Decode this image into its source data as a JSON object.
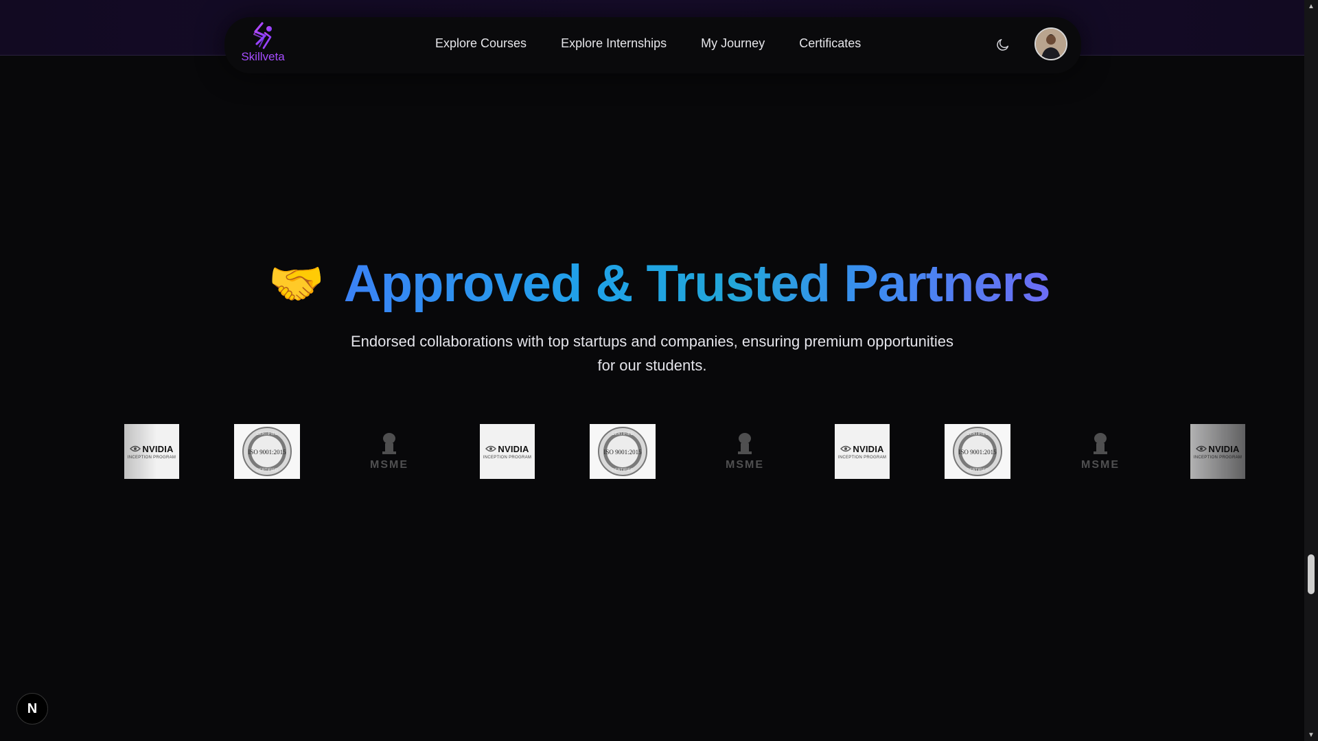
{
  "brand": {
    "name": "Skillveta",
    "color": "#a64dff"
  },
  "nav": {
    "links": [
      {
        "label": "Explore Courses"
      },
      {
        "label": "Explore Internships"
      },
      {
        "label": "My Journey"
      },
      {
        "label": "Certificates"
      }
    ],
    "theme_icon": "moon-icon",
    "avatar_icon": "user-avatar"
  },
  "hero": {
    "emoji": "🤝",
    "heading": "Approved & Trusted Partners",
    "subtitle_line1": "Endorsed collaborations with top startups and companies, ensuring premium opportunities",
    "subtitle_line2": "for our students.",
    "heading_gradient": [
      "#3b82f6",
      "#1fa2e8",
      "#6d6df5"
    ]
  },
  "partners": {
    "nvidia_name": "NVIDIA",
    "nvidia_sub": "INCEPTION PROGRAM",
    "iso_text": "ISO 9001:2015",
    "iso_ring": "CERTIFIED",
    "msme_text": "MSME",
    "sequence": [
      "nvidia",
      "iso",
      "msme",
      "nvidia",
      "iso",
      "msme",
      "nvidia",
      "iso",
      "msme",
      "nvidia"
    ]
  },
  "dev_badge": {
    "label": "N"
  },
  "colors": {
    "background": "#08080a",
    "navbar": "#0a0a0c",
    "top_band": "#140b26",
    "text": "#e6e6ea"
  }
}
